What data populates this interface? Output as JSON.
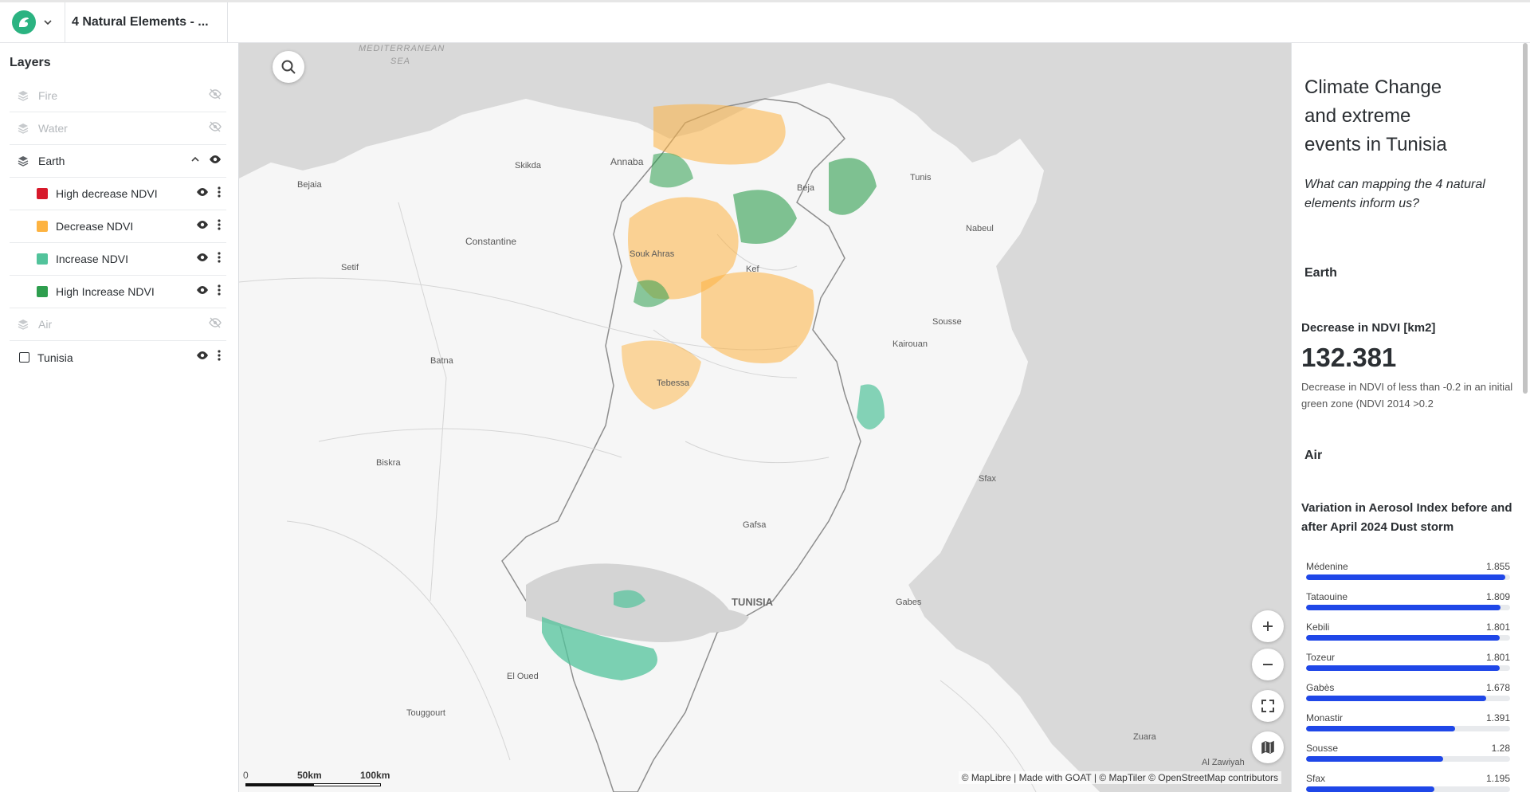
{
  "header": {
    "project_title": "4 Natural Elements - ..."
  },
  "layers": {
    "title": "Layers",
    "groups": [
      {
        "label": "Fire"
      },
      {
        "label": "Water"
      },
      {
        "label": "Earth"
      },
      {
        "label": "Air"
      },
      {
        "label": "Tunisia"
      }
    ],
    "earth_children": [
      {
        "label": "High decrease NDVI",
        "color": "#d7192b"
      },
      {
        "label": "Decrease NDVI",
        "color": "#fdb341"
      },
      {
        "label": "Increase NDVI",
        "color": "#52c39b"
      },
      {
        "label": "High Increase NDVI",
        "color": "#2e9e4e"
      }
    ]
  },
  "map": {
    "places": [
      "MEDITERRANEAN",
      "SEA",
      "Skikda",
      "Annaba",
      "Bejaia",
      "Constantine",
      "Souk Ahras",
      "Setif",
      "Batna",
      "Tebessa",
      "Biskra",
      "El Oued",
      "Touggourt",
      "TUNISIA",
      "Gafsa",
      "Gabes",
      "Sfax",
      "Sousse",
      "Kairouan",
      "Tunis",
      "Beja",
      "Nabeul",
      "Kef",
      "Zuara",
      "Al Zawiyah"
    ],
    "attribution": "© MapLibre | Made with GOAT | © MapTiler © OpenStreetMap contributors",
    "scale": {
      "zero": "0",
      "mid": "50km",
      "end": "100km"
    }
  },
  "panel": {
    "title": "Climate Change and extreme events in Tunisia",
    "subtitle": "What can mapping the 4 natural elements inform us?",
    "earth_heading": "Earth",
    "ndvi_heading": "Decrease in NDVI [km2]",
    "ndvi_value": "132.381",
    "ndvi_desc": "Decrease in NDVI of less than -0.2 in an initial green zone (NDVI 2014 >0.2",
    "air_heading": "Air",
    "aerosol_heading": "Variation in Aerosol Index before and after April 2024 Dust storm"
  },
  "colors": {
    "accent": "#2bb381",
    "bar": "#1f47e8"
  },
  "chart_data": {
    "type": "bar",
    "title": "Variation in Aerosol Index before and after April 2024 Dust storm",
    "categories": [
      "Médenine",
      "Tataouine",
      "Kebili",
      "Tozeur",
      "Gabès",
      "Monastir",
      "Sousse",
      "Sfax"
    ],
    "values": [
      1.855,
      1.809,
      1.801,
      1.801,
      1.678,
      1.391,
      1.28,
      1.195
    ],
    "labels": [
      "1.855",
      "1.809",
      "1.801",
      "1.801",
      "1.678",
      "1.391",
      "1.28",
      "1.195"
    ],
    "xlim": [
      0,
      1.9
    ]
  }
}
